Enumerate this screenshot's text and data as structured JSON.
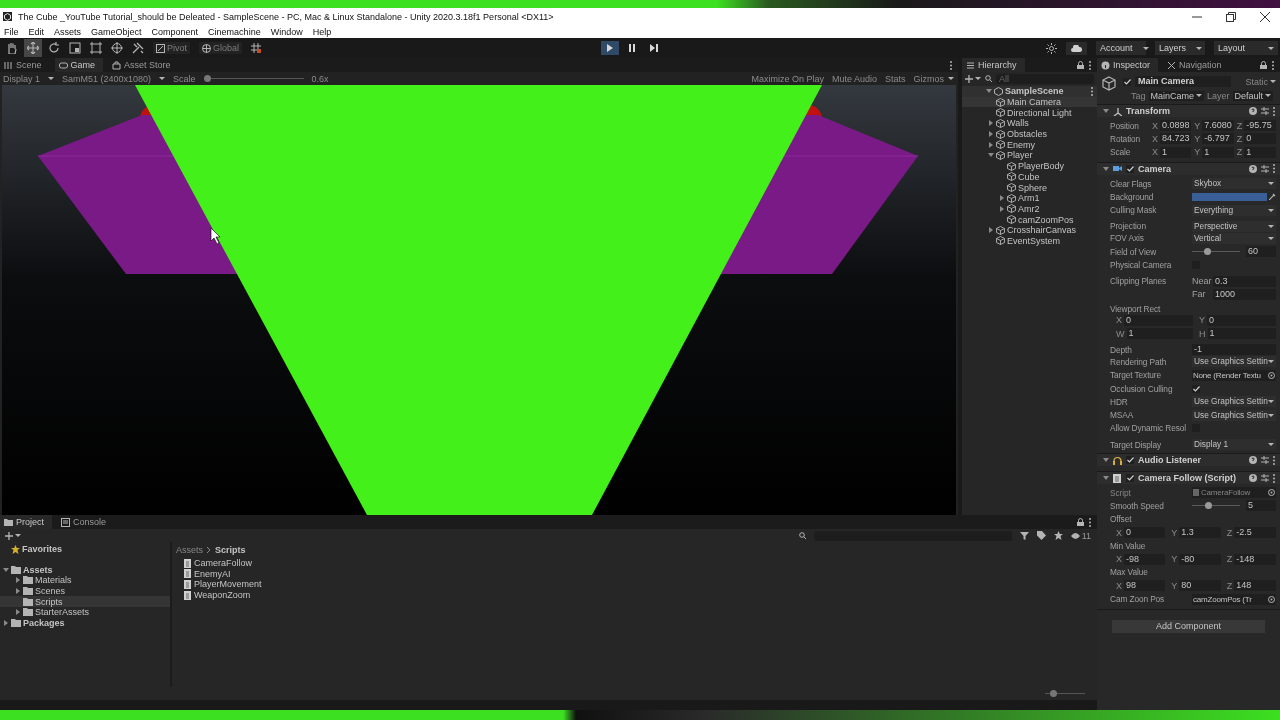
{
  "window": {
    "title": "The Cube _YouTube Tutorial_should be Deleated - SampleScene - PC, Mac & Linux Standalone - Unity 2020.3.18f1 Personal <DX11>"
  },
  "menu": [
    "File",
    "Edit",
    "Assets",
    "GameObject",
    "Component",
    "Cinemachine",
    "Window",
    "Help"
  ],
  "toolbar": {
    "tools": [
      {
        "kind": "hand",
        "selected": false
      },
      {
        "kind": "move",
        "selected": true
      },
      {
        "kind": "rotate",
        "selected": false
      },
      {
        "kind": "scale",
        "selected": false
      },
      {
        "kind": "rect",
        "selected": false
      },
      {
        "kind": "transform",
        "selected": false
      },
      {
        "kind": "custom",
        "selected": false
      }
    ],
    "pivot": "Pivot",
    "global": "Global",
    "play": [
      {
        "kind": "play",
        "selected": true
      },
      {
        "kind": "pause",
        "selected": false
      },
      {
        "kind": "step",
        "selected": false
      }
    ],
    "account": "Account",
    "layers": "Layers",
    "layout": "Layout"
  },
  "scene_tabs": [
    {
      "label": "Scene",
      "kind": "scene",
      "selected": false
    },
    {
      "label": "Game",
      "kind": "game",
      "selected": true
    },
    {
      "label": "Asset Store",
      "kind": "store",
      "selected": false
    }
  ],
  "game_bar": {
    "display": "Display 1",
    "resolution": "SamM51 (2400x1080)",
    "scale_label": "Scale",
    "scale": {
      "level": 0
    },
    "scale_value": "0.6x",
    "buttons": [
      "Maximize On Play",
      "Mute Audio",
      "Stats"
    ],
    "gizmos": "Gizmos"
  },
  "hierarchy": {
    "tab": "Hierarchy",
    "search_placeholder": "All",
    "scene": {
      "name": "SampleScene",
      "expanded": true,
      "children": [
        {
          "name": "Main Camera",
          "selected": true
        },
        {
          "name": "Directional Light",
          "selected": false
        },
        {
          "name": "Walls",
          "expanded": false,
          "selected": false
        },
        {
          "name": "Obstacles",
          "expanded": false,
          "selected": false
        },
        {
          "name": "Enemy",
          "expanded": false,
          "selected": false
        },
        {
          "name": "Player",
          "expanded": true,
          "selected": false,
          "children": [
            {
              "name": "PlayerBody",
              "selected": false
            },
            {
              "name": "Cube",
              "selected": false
            },
            {
              "name": "Sphere",
              "selected": false
            },
            {
              "name": "Arm1",
              "expanded": false,
              "selected": false
            },
            {
              "name": "Amr2",
              "expanded": false,
              "selected": false
            },
            {
              "name": "camZoomPos",
              "selected": false
            }
          ]
        },
        {
          "name": "CrosshairCanvas",
          "expanded": false,
          "selected": false
        },
        {
          "name": "EventSystem",
          "selected": false
        }
      ]
    }
  },
  "inspector": {
    "tabs": [
      {
        "label": "Inspector",
        "selected": true
      },
      {
        "label": "Navigation",
        "selected": false
      }
    ],
    "object": {
      "name": "Main Camera",
      "active": true,
      "static": "Static",
      "tag_label": "Tag",
      "tag": "MainCame",
      "layer_label": "Layer",
      "layer": "Default"
    },
    "components": [
      {
        "title": "Transform",
        "kind": "transform",
        "rows": [
          {
            "kind": "vec",
            "label": "Position",
            "axes": [
              {
                "axis": "X",
                "value": "0.0898"
              },
              {
                "axis": "Y",
                "value": "7.6080"
              },
              {
                "axis": "Z",
                "value": "-95.75"
              }
            ]
          },
          {
            "kind": "vec",
            "label": "Rotation",
            "axes": [
              {
                "axis": "X",
                "value": "84.723"
              },
              {
                "axis": "Y",
                "value": "-6.797"
              },
              {
                "axis": "Z",
                "value": "0"
              }
            ]
          },
          {
            "kind": "vec",
            "label": "Scale",
            "axes": [
              {
                "axis": "X",
                "value": "1"
              },
              {
                "axis": "Y",
                "value": "1"
              },
              {
                "axis": "Z",
                "value": "1"
              }
            ]
          }
        ]
      },
      {
        "title": "Camera",
        "kind": "camera",
        "enabled": true,
        "rows": [
          {
            "kind": "dropdown",
            "label": "Clear Flags",
            "value": "Skybox"
          },
          {
            "kind": "color",
            "label": "Background",
            "color": "#3a5f96"
          },
          {
            "kind": "dropdown",
            "label": "Culling Mask",
            "value": "Everything"
          },
          {
            "kind": "dropdown",
            "label": "Projection",
            "value": "Perspective",
            "gap": true
          },
          {
            "kind": "dropdown",
            "label": "FOV Axis",
            "value": "Vertical"
          },
          {
            "kind": "slider",
            "label": "Field of View",
            "level": 0.33,
            "value": "60"
          },
          {
            "kind": "checkbox",
            "label": "Physical Camera",
            "checked": false
          },
          {
            "kind": "stack",
            "label": "Clipping Planes",
            "gap": true,
            "fields": [
              {
                "axis": "Near",
                "value": "0.3"
              },
              {
                "axis": "Far",
                "value": "1000"
              }
            ]
          },
          {
            "kind": "heading",
            "label": "Viewport Rect",
            "gap": true
          },
          {
            "kind": "vec",
            "axes": [
              {
                "axis": "X",
                "value": "0"
              },
              {
                "axis": "Y",
                "value": "0"
              }
            ]
          },
          {
            "kind": "vec",
            "axes": [
              {
                "axis": "W",
                "value": "1"
              },
              {
                "axis": "H",
                "value": "1"
              }
            ]
          },
          {
            "kind": "field",
            "label": "Depth",
            "value": "-1",
            "gap": true
          },
          {
            "kind": "dropdown",
            "label": "Rendering Path",
            "value": "Use Graphics Settin"
          },
          {
            "kind": "object",
            "label": "Target Texture",
            "value": "None (Render Textu"
          },
          {
            "kind": "checkbox",
            "label": "Occlusion Culling",
            "checked": true
          },
          {
            "kind": "dropdown",
            "label": "HDR",
            "value": "Use Graphics Settin"
          },
          {
            "kind": "dropdown",
            "label": "MSAA",
            "value": "Use Graphics Settin"
          },
          {
            "kind": "checkbox",
            "label": "Allow Dynamic Resol",
            "checked": false
          },
          {
            "kind": "dropdown",
            "label": "Target Display",
            "value": "Display 1",
            "gap": true
          }
        ]
      },
      {
        "title": "Audio Listener",
        "kind": "audio",
        "enabled": true
      },
      {
        "title": "Camera Follow (Script)",
        "kind": "script",
        "enabled": true,
        "rows": [
          {
            "kind": "object",
            "label": "Script",
            "value": "CameraFollow",
            "disabled": true
          },
          {
            "kind": "slider",
            "label": "Smooth Speed",
            "level": 0.35,
            "value": "5"
          },
          {
            "kind": "heading",
            "label": "Offset"
          },
          {
            "kind": "vec",
            "axes": [
              {
                "axis": "X",
                "value": "0"
              },
              {
                "axis": "Y",
                "value": "1.3"
              },
              {
                "axis": "Z",
                "value": "-2.5"
              }
            ]
          },
          {
            "kind": "heading",
            "label": "Min Value"
          },
          {
            "kind": "vec",
            "axes": [
              {
                "axis": "X",
                "value": "-98"
              },
              {
                "axis": "Y",
                "value": "-80"
              },
              {
                "axis": "Z",
                "value": "-148"
              }
            ]
          },
          {
            "kind": "heading",
            "label": "Max Value"
          },
          {
            "kind": "vec",
            "axes": [
              {
                "axis": "X",
                "value": "98"
              },
              {
                "axis": "Y",
                "value": "80"
              },
              {
                "axis": "Z",
                "value": "148"
              }
            ]
          },
          {
            "kind": "object",
            "label": "Cam Zoon Pos",
            "value": "camZoomPos (Tr"
          }
        ]
      }
    ],
    "add_component": "Add Component"
  },
  "project": {
    "tabs": [
      {
        "label": "Project",
        "kind": "project",
        "selected": true
      },
      {
        "label": "Console",
        "kind": "console",
        "selected": false
      }
    ],
    "hidden_count": "11",
    "tree": [
      {
        "name": "Favorites",
        "kind": "favorites",
        "selected": false
      },
      {
        "name": "Assets",
        "kind": "folder",
        "expanded": true,
        "selected": false,
        "children": [
          {
            "name": "Materials",
            "kind": "folder",
            "expanded": false,
            "selected": false
          },
          {
            "name": "Scenes",
            "kind": "folder",
            "expanded": false,
            "selected": false
          },
          {
            "name": "Scripts",
            "kind": "folder",
            "selected": true
          },
          {
            "name": "StarterAssets",
            "kind": "folder",
            "expanded": false,
            "selected": false
          }
        ]
      },
      {
        "name": "Packages",
        "kind": "folder",
        "expanded": false,
        "selected": false
      }
    ],
    "breadcrumb": [
      "Assets",
      "Scripts"
    ],
    "files": [
      "CameraFollow",
      "EnemyAI",
      "PlayerMovement",
      "WeaponZoom"
    ],
    "zoom": {
      "level": 0.2
    }
  }
}
